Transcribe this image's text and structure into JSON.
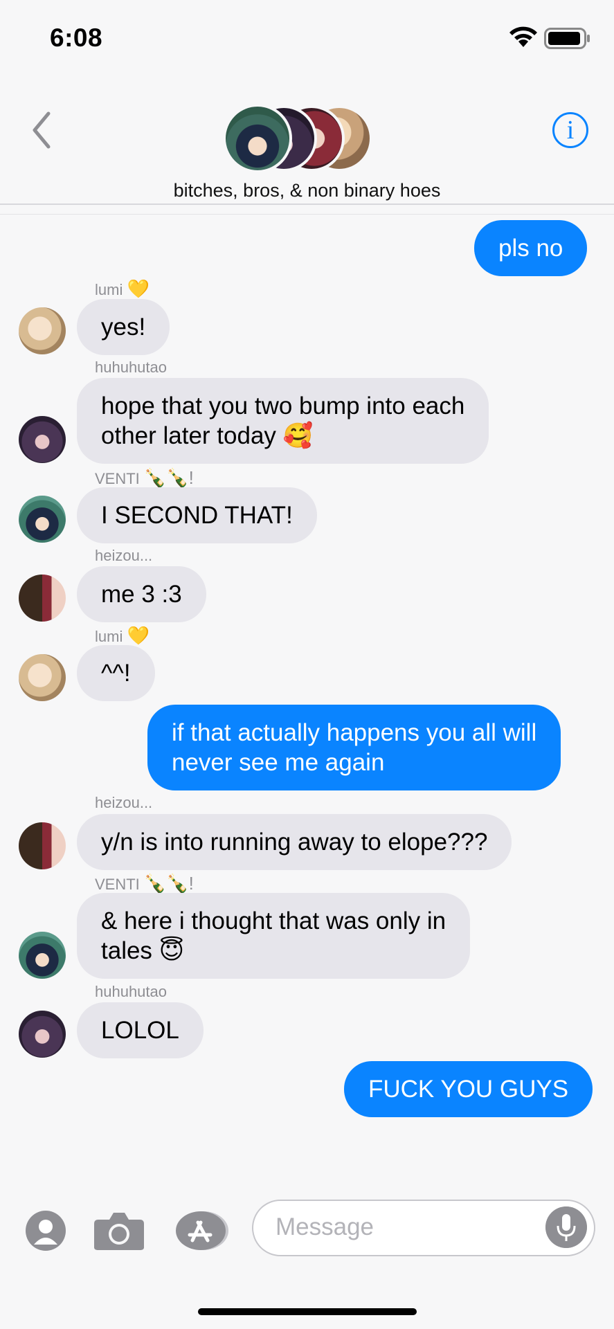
{
  "status": {
    "time": "6:08"
  },
  "header": {
    "group_name": "bitches, bros, & non binary hoes",
    "info_label": "i"
  },
  "messages": [
    {
      "kind": "out",
      "text": "pls no"
    },
    {
      "kind": "in",
      "sender": "lumi",
      "sender_emoji": "💛",
      "text": "yes!"
    },
    {
      "kind": "in",
      "sender": "huhuhutao",
      "sender_emoji": "",
      "text_line1": "hope that you two bump into each",
      "text_line2": "other later today",
      "emoji": "🥰"
    },
    {
      "kind": "in",
      "sender": "VENTI",
      "sender_emoji": "🍾🍾!",
      "text": "I SECOND THAT!"
    },
    {
      "kind": "in",
      "sender": "heizou...",
      "sender_emoji": "",
      "text": "me 3 :3"
    },
    {
      "kind": "in",
      "sender": "lumi",
      "sender_emoji": "💛",
      "text": "^^!"
    },
    {
      "kind": "out",
      "text_line1": "if that actually happens you all will",
      "text_line2": "never see me again"
    },
    {
      "kind": "in",
      "sender": "heizou...",
      "sender_emoji": "",
      "text": "y/n is into running away to elope???"
    },
    {
      "kind": "in",
      "sender": "VENTI",
      "sender_emoji": "🍾🍾!",
      "text_line1": "& here i thought that was only in",
      "text_line2": "tales",
      "emoji": "😇"
    },
    {
      "kind": "in",
      "sender": "huhuhutao",
      "sender_emoji": "",
      "text": "LOLOL"
    },
    {
      "kind": "out",
      "text": "FUCK YOU GUYS"
    }
  ],
  "composer": {
    "placeholder": "Message"
  },
  "colors": {
    "accent": "#0a84ff",
    "incoming_bubble": "#e6e5eb",
    "background": "#f7f7f8"
  }
}
